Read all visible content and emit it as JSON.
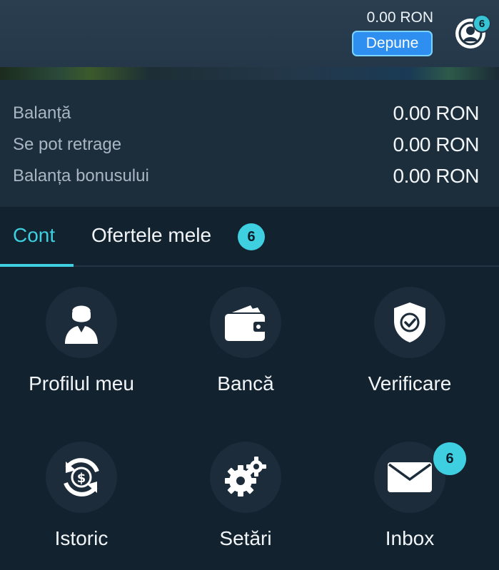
{
  "header": {
    "balance": "0.00 RON",
    "deposit_label": "Depune",
    "notifications_count": "6"
  },
  "balances": [
    {
      "label": "Balanță",
      "value": "0.00 RON"
    },
    {
      "label": "Se pot retrage",
      "value": "0.00 RON"
    },
    {
      "label": "Balanța bonusului",
      "value": "0.00 RON"
    }
  ],
  "tabs": {
    "active": "Cont",
    "offers": "Ofertele mele",
    "offers_badge": "6",
    "accent_color": "#3ecfe0"
  },
  "menu": [
    {
      "label": "Profilul meu",
      "icon": "user-profile-icon"
    },
    {
      "label": "Bancă",
      "icon": "wallet-icon"
    },
    {
      "label": "Verificare",
      "icon": "shield-check-icon"
    },
    {
      "label": "Istoric",
      "icon": "money-history-icon"
    },
    {
      "label": "Setări",
      "icon": "gears-icon"
    },
    {
      "label": "Inbox",
      "icon": "envelope-icon",
      "badge": "6"
    }
  ]
}
